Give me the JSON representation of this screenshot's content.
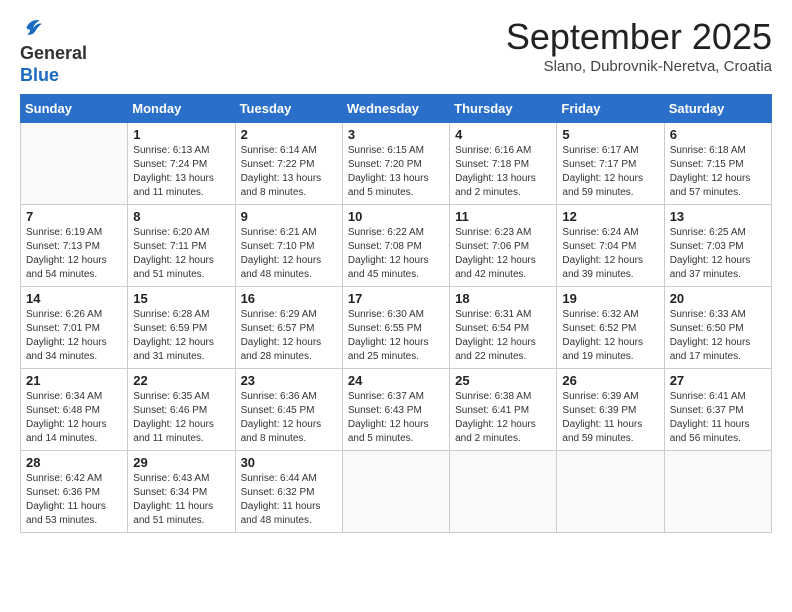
{
  "header": {
    "logo_general": "General",
    "logo_blue": "Blue",
    "month_title": "September 2025",
    "location": "Slano, Dubrovnik-Neretva, Croatia"
  },
  "weekdays": [
    "Sunday",
    "Monday",
    "Tuesday",
    "Wednesday",
    "Thursday",
    "Friday",
    "Saturday"
  ],
  "weeks": [
    [
      {
        "day": "",
        "info": ""
      },
      {
        "day": "1",
        "info": "Sunrise: 6:13 AM\nSunset: 7:24 PM\nDaylight: 13 hours\nand 11 minutes."
      },
      {
        "day": "2",
        "info": "Sunrise: 6:14 AM\nSunset: 7:22 PM\nDaylight: 13 hours\nand 8 minutes."
      },
      {
        "day": "3",
        "info": "Sunrise: 6:15 AM\nSunset: 7:20 PM\nDaylight: 13 hours\nand 5 minutes."
      },
      {
        "day": "4",
        "info": "Sunrise: 6:16 AM\nSunset: 7:18 PM\nDaylight: 13 hours\nand 2 minutes."
      },
      {
        "day": "5",
        "info": "Sunrise: 6:17 AM\nSunset: 7:17 PM\nDaylight: 12 hours\nand 59 minutes."
      },
      {
        "day": "6",
        "info": "Sunrise: 6:18 AM\nSunset: 7:15 PM\nDaylight: 12 hours\nand 57 minutes."
      }
    ],
    [
      {
        "day": "7",
        "info": "Sunrise: 6:19 AM\nSunset: 7:13 PM\nDaylight: 12 hours\nand 54 minutes."
      },
      {
        "day": "8",
        "info": "Sunrise: 6:20 AM\nSunset: 7:11 PM\nDaylight: 12 hours\nand 51 minutes."
      },
      {
        "day": "9",
        "info": "Sunrise: 6:21 AM\nSunset: 7:10 PM\nDaylight: 12 hours\nand 48 minutes."
      },
      {
        "day": "10",
        "info": "Sunrise: 6:22 AM\nSunset: 7:08 PM\nDaylight: 12 hours\nand 45 minutes."
      },
      {
        "day": "11",
        "info": "Sunrise: 6:23 AM\nSunset: 7:06 PM\nDaylight: 12 hours\nand 42 minutes."
      },
      {
        "day": "12",
        "info": "Sunrise: 6:24 AM\nSunset: 7:04 PM\nDaylight: 12 hours\nand 39 minutes."
      },
      {
        "day": "13",
        "info": "Sunrise: 6:25 AM\nSunset: 7:03 PM\nDaylight: 12 hours\nand 37 minutes."
      }
    ],
    [
      {
        "day": "14",
        "info": "Sunrise: 6:26 AM\nSunset: 7:01 PM\nDaylight: 12 hours\nand 34 minutes."
      },
      {
        "day": "15",
        "info": "Sunrise: 6:28 AM\nSunset: 6:59 PM\nDaylight: 12 hours\nand 31 minutes."
      },
      {
        "day": "16",
        "info": "Sunrise: 6:29 AM\nSunset: 6:57 PM\nDaylight: 12 hours\nand 28 minutes."
      },
      {
        "day": "17",
        "info": "Sunrise: 6:30 AM\nSunset: 6:55 PM\nDaylight: 12 hours\nand 25 minutes."
      },
      {
        "day": "18",
        "info": "Sunrise: 6:31 AM\nSunset: 6:54 PM\nDaylight: 12 hours\nand 22 minutes."
      },
      {
        "day": "19",
        "info": "Sunrise: 6:32 AM\nSunset: 6:52 PM\nDaylight: 12 hours\nand 19 minutes."
      },
      {
        "day": "20",
        "info": "Sunrise: 6:33 AM\nSunset: 6:50 PM\nDaylight: 12 hours\nand 17 minutes."
      }
    ],
    [
      {
        "day": "21",
        "info": "Sunrise: 6:34 AM\nSunset: 6:48 PM\nDaylight: 12 hours\nand 14 minutes."
      },
      {
        "day": "22",
        "info": "Sunrise: 6:35 AM\nSunset: 6:46 PM\nDaylight: 12 hours\nand 11 minutes."
      },
      {
        "day": "23",
        "info": "Sunrise: 6:36 AM\nSunset: 6:45 PM\nDaylight: 12 hours\nand 8 minutes."
      },
      {
        "day": "24",
        "info": "Sunrise: 6:37 AM\nSunset: 6:43 PM\nDaylight: 12 hours\nand 5 minutes."
      },
      {
        "day": "25",
        "info": "Sunrise: 6:38 AM\nSunset: 6:41 PM\nDaylight: 12 hours\nand 2 minutes."
      },
      {
        "day": "26",
        "info": "Sunrise: 6:39 AM\nSunset: 6:39 PM\nDaylight: 11 hours\nand 59 minutes."
      },
      {
        "day": "27",
        "info": "Sunrise: 6:41 AM\nSunset: 6:37 PM\nDaylight: 11 hours\nand 56 minutes."
      }
    ],
    [
      {
        "day": "28",
        "info": "Sunrise: 6:42 AM\nSunset: 6:36 PM\nDaylight: 11 hours\nand 53 minutes."
      },
      {
        "day": "29",
        "info": "Sunrise: 6:43 AM\nSunset: 6:34 PM\nDaylight: 11 hours\nand 51 minutes."
      },
      {
        "day": "30",
        "info": "Sunrise: 6:44 AM\nSunset: 6:32 PM\nDaylight: 11 hours\nand 48 minutes."
      },
      {
        "day": "",
        "info": ""
      },
      {
        "day": "",
        "info": ""
      },
      {
        "day": "",
        "info": ""
      },
      {
        "day": "",
        "info": ""
      }
    ]
  ]
}
